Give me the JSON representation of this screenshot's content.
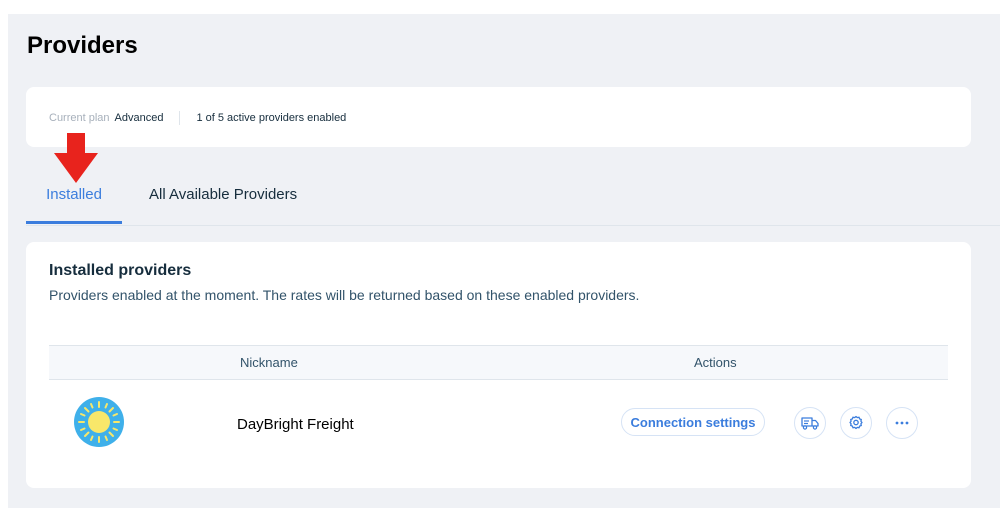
{
  "page": {
    "title": "Providers"
  },
  "plan": {
    "label": "Current plan",
    "value": "Advanced",
    "status": "1 of 5 active providers enabled"
  },
  "tabs": [
    {
      "label": "Installed",
      "active": true
    },
    {
      "label": "All Available Providers",
      "active": false
    }
  ],
  "installed": {
    "title": "Installed providers",
    "description": "Providers enabled at the moment. The rates will be returned based on these enabled providers.",
    "columns": {
      "nickname": "Nickname",
      "actions": "Actions"
    },
    "rows": [
      {
        "nickname": "DayBright Freight",
        "logo_icon": "sun-icon",
        "actions": {
          "connection_settings": "Connection settings",
          "icons": [
            "truck-icon",
            "gear-icon",
            "more-icon"
          ]
        }
      }
    ]
  },
  "colors": {
    "accent": "#3b7ddd",
    "arrow": "#e8231d",
    "logo_bg": "#3fb0ea",
    "sun": "#f8e76a"
  }
}
